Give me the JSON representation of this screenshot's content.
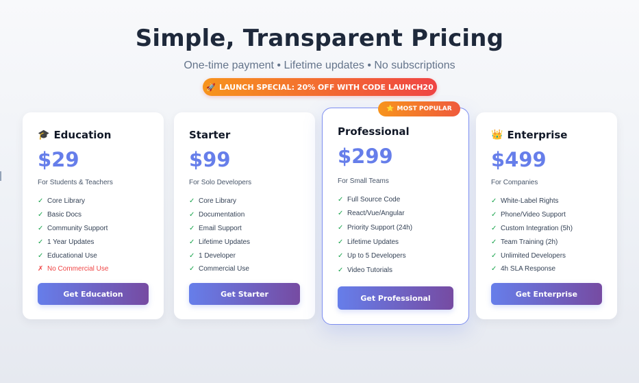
{
  "header": {
    "title": "Simple, Transparent Pricing",
    "subtitle": "One-time payment • Lifetime updates • No subscriptions",
    "promo_icon": "🚀",
    "promo_text": "LAUNCH SPECIAL: 20% OFF WITH CODE LAUNCH20"
  },
  "popular_badge": {
    "icon": "⭐",
    "text": "MOST POPULAR"
  },
  "colors": {
    "accent": "#667eea",
    "accent_end": "#764ba2",
    "promo_start": "#f7941d",
    "promo_end": "#ef4444",
    "check": "#16a34a",
    "negative": "#ef4444"
  },
  "plans": [
    {
      "icon": "🎓",
      "name": "Education",
      "price": "$29",
      "audience": "For Students & Teachers",
      "features": [
        "Core Library",
        "Basic Docs",
        "Community Support",
        "1 Year Updates",
        "Educational Use"
      ],
      "excluded": "No Commercial Use",
      "cta": "Get Education"
    },
    {
      "icon": "",
      "name": "Starter",
      "price": "$99",
      "audience": "For Solo Developers",
      "features": [
        "Core Library",
        "Documentation",
        "Email Support",
        "Lifetime Updates",
        "1 Developer",
        "Commercial Use"
      ],
      "cta": "Get Starter"
    },
    {
      "icon": "",
      "name": "Professional",
      "price": "$299",
      "audience": "For Small Teams",
      "features": [
        "Full Source Code",
        "React/Vue/Angular",
        "Priority Support (24h)",
        "Lifetime Updates",
        "Up to 5 Developers",
        "Video Tutorials"
      ],
      "cta": "Get Professional"
    },
    {
      "icon": "👑",
      "name": "Enterprise",
      "price": "$499",
      "audience": "For Companies",
      "features": [
        "White-Label Rights",
        "Phone/Video Support",
        "Custom Integration (5h)",
        "Team Training (2h)",
        "Unlimited Developers",
        "4h SLA Response"
      ],
      "cta": "Get Enterprise"
    }
  ],
  "glyphs": {
    "check": "✓",
    "cross": "✗"
  }
}
